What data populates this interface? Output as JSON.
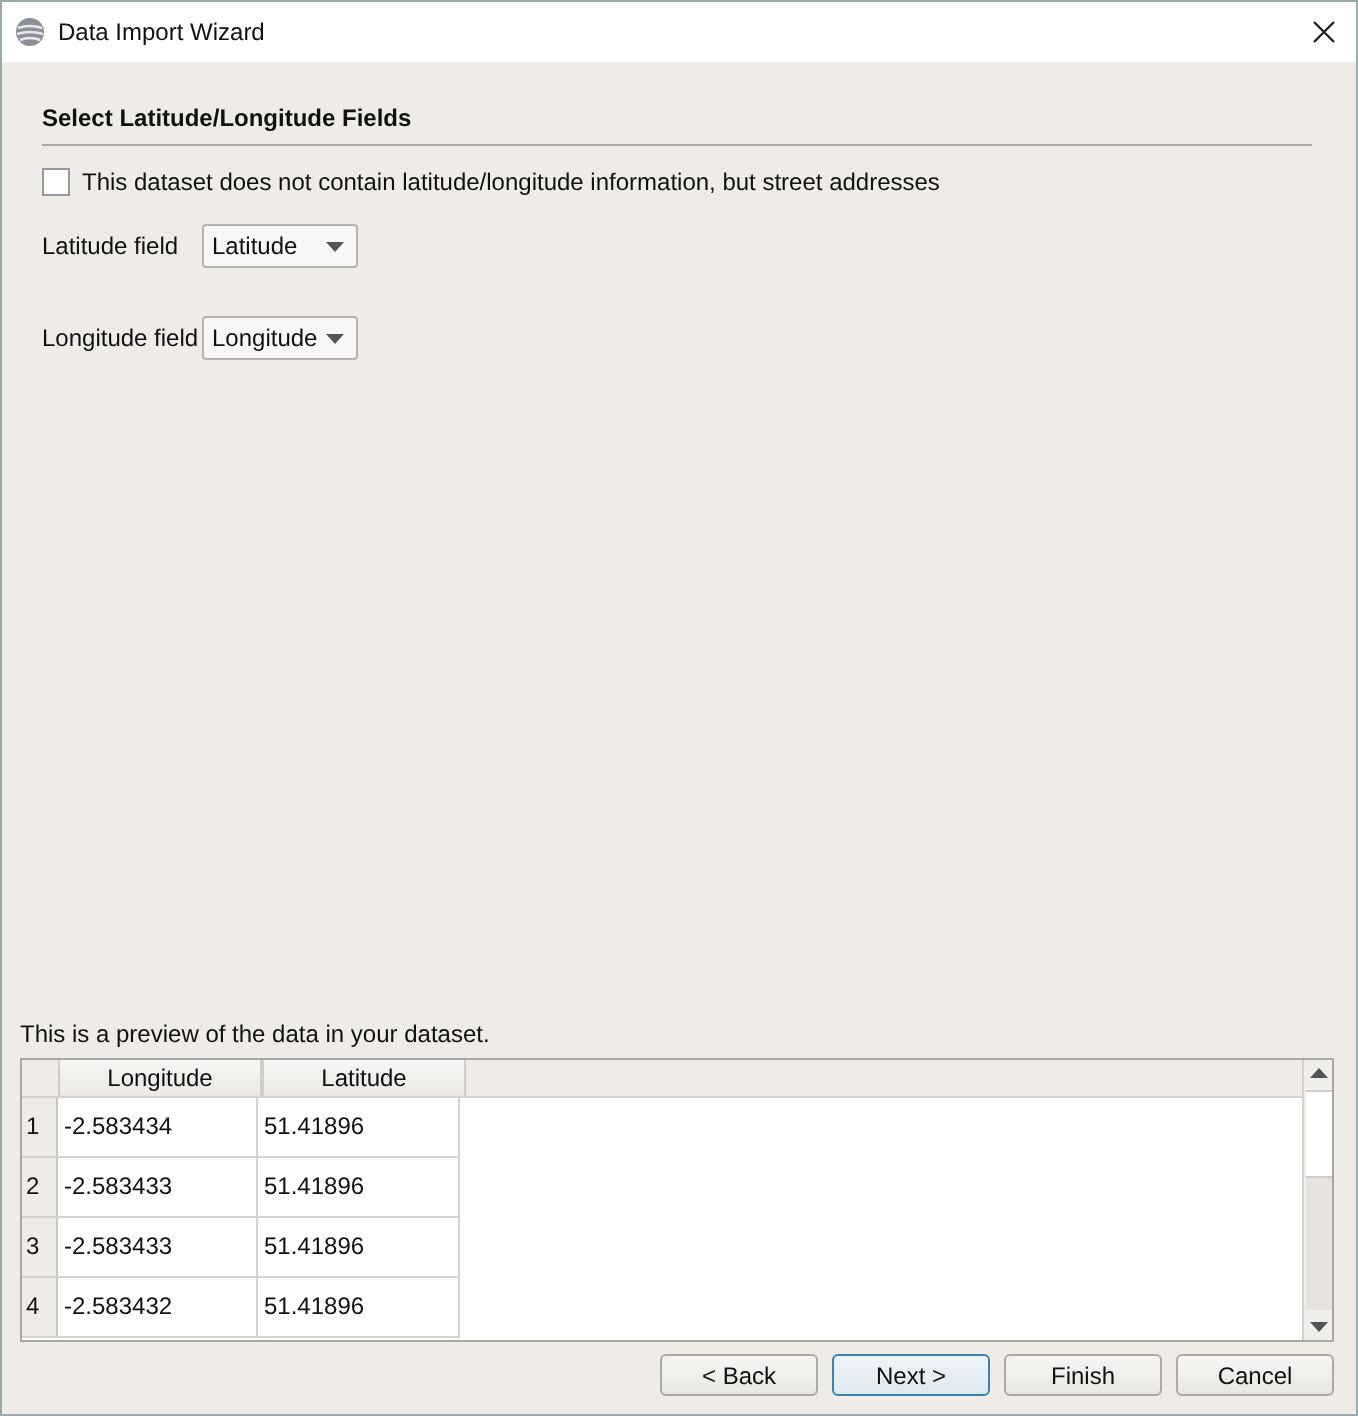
{
  "window": {
    "title": "Data Import Wizard"
  },
  "heading": "Select Latitude/Longitude Fields",
  "address_option": {
    "label": "This dataset does not contain latitude/longitude information, but street addresses",
    "checked": false
  },
  "fields": [
    {
      "label": "Latitude field",
      "value": "Latitude"
    },
    {
      "label": "Longitude field",
      "value": "Longitude"
    }
  ],
  "preview": {
    "caption": "This is a preview of the data in your dataset.",
    "columns": [
      "Longitude",
      "Latitude"
    ],
    "rows": [
      {
        "index": "1",
        "cells": [
          "-2.583434",
          "51.41896"
        ]
      },
      {
        "index": "2",
        "cells": [
          "-2.583433",
          "51.41896"
        ]
      },
      {
        "index": "3",
        "cells": [
          "-2.583433",
          "51.41896"
        ]
      },
      {
        "index": "4",
        "cells": [
          "-2.583432",
          "51.41896"
        ]
      }
    ]
  },
  "buttons": [
    {
      "label": "< Back",
      "default": false
    },
    {
      "label": "Next >",
      "default": true
    },
    {
      "label": "Finish",
      "default": false
    },
    {
      "label": "Cancel",
      "default": false
    }
  ]
}
